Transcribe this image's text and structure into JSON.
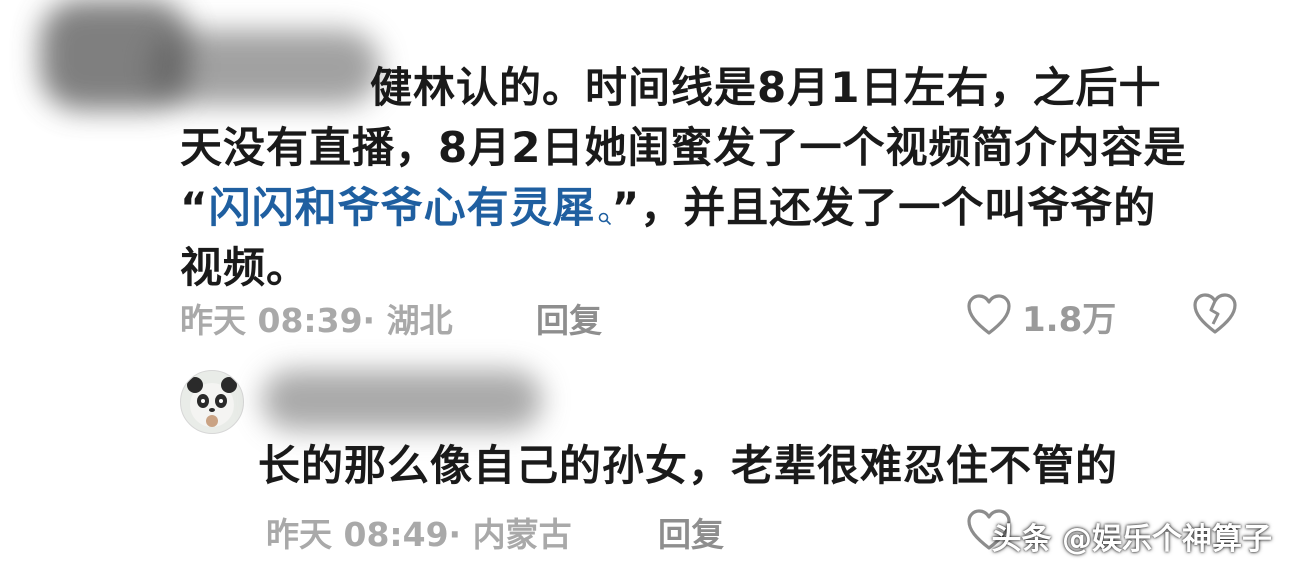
{
  "comment1": {
    "text_line1": "健林认的。时间线是8月1日左右，之后十",
    "text_line2": "天没有直播，8月2日她闺蜜发了一个视频简介内容是",
    "quote_open": "“",
    "hashtag": "闪闪和爷爷心有灵犀",
    "quote_close": "”，并且还发了一个叫爷爷的",
    "text_line4": "视频。",
    "time": "昨天 08:39",
    "separator": "·",
    "location": "湖北",
    "reply_label": "回复",
    "like_count": "1.8万"
  },
  "comment2": {
    "text": "长的那么像自己的孙女，老辈很难忍住不管的",
    "time": "昨天 08:49",
    "separator": "·",
    "location": "内蒙古",
    "reply_label": "回复"
  },
  "watermark": "头条 @娱乐个神算子",
  "colors": {
    "text": "#1a1a1a",
    "meta": "#a9a9a9",
    "link": "#1f5fa0"
  },
  "icons": [
    "heart-icon",
    "broken-heart-icon",
    "search-icon",
    "panda-avatar"
  ]
}
